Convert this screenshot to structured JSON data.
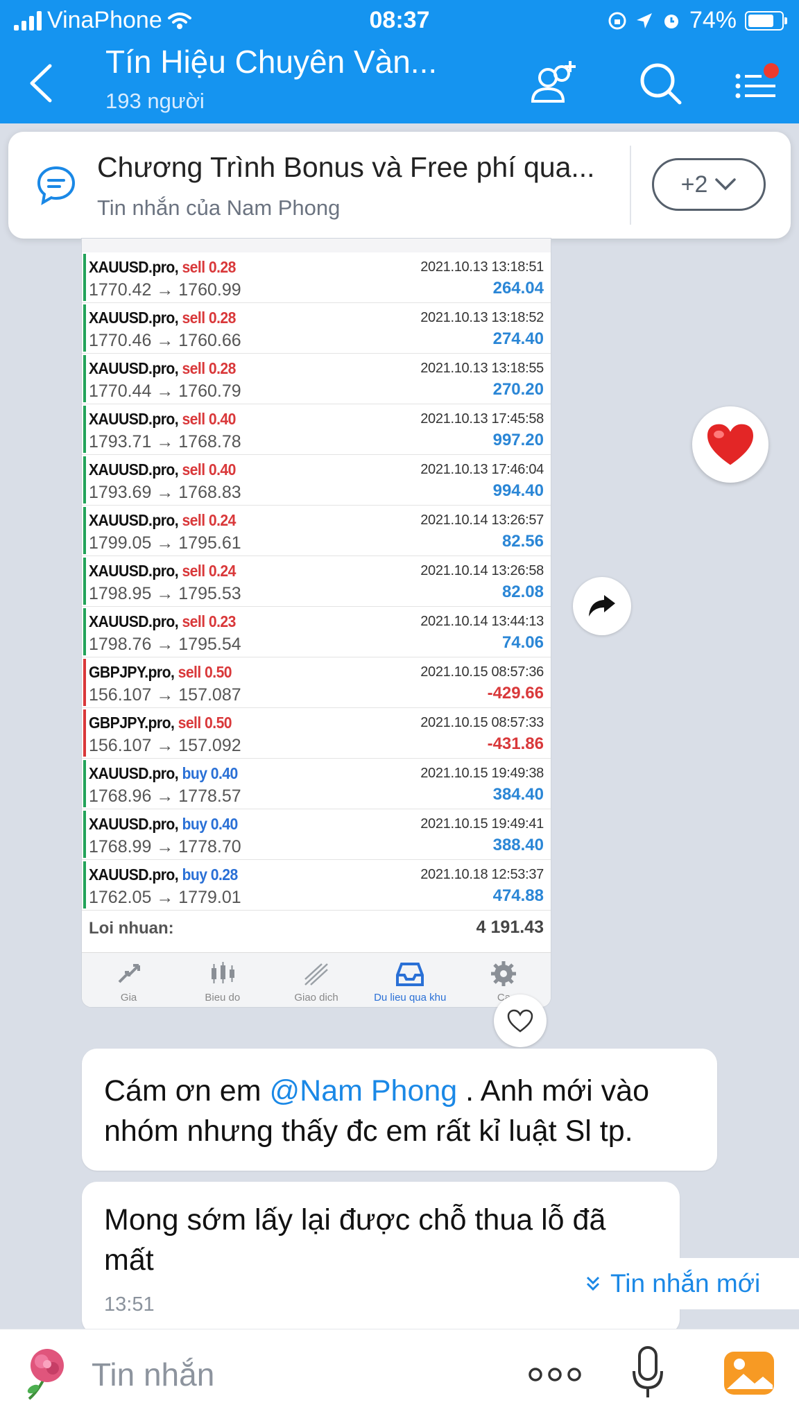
{
  "status_bar": {
    "carrier": "VinaPhone",
    "time": "08:37",
    "battery": "74%"
  },
  "header": {
    "title": "Tín Hiệu Chuyên Vàn...",
    "member_count": "193 người"
  },
  "pinned": {
    "title": "Chương Trình Bonus và Free phí qua...",
    "subtitle": "Tin nhắn của Nam Phong",
    "more_count": "+2"
  },
  "trades": [
    {
      "symbol": "XAUUSD.pro,",
      "side": "sell",
      "volume": "0.28",
      "prices": "1770.42 → 1760.99",
      "date": "2021.10.13 13:18:51",
      "profit": "264.04",
      "loss": false
    },
    {
      "symbol": "XAUUSD.pro,",
      "side": "sell",
      "volume": "0.28",
      "prices": "1770.46 → 1760.66",
      "date": "2021.10.13 13:18:52",
      "profit": "274.40",
      "loss": false
    },
    {
      "symbol": "XAUUSD.pro,",
      "side": "sell",
      "volume": "0.28",
      "prices": "1770.44 → 1760.79",
      "date": "2021.10.13 13:18:55",
      "profit": "270.20",
      "loss": false
    },
    {
      "symbol": "XAUUSD.pro,",
      "side": "sell",
      "volume": "0.40",
      "prices": "1793.71 → 1768.78",
      "date": "2021.10.13 17:45:58",
      "profit": "997.20",
      "loss": false
    },
    {
      "symbol": "XAUUSD.pro,",
      "side": "sell",
      "volume": "0.40",
      "prices": "1793.69 → 1768.83",
      "date": "2021.10.13 17:46:04",
      "profit": "994.40",
      "loss": false
    },
    {
      "symbol": "XAUUSD.pro,",
      "side": "sell",
      "volume": "0.24",
      "prices": "1799.05 → 1795.61",
      "date": "2021.10.14 13:26:57",
      "profit": "82.56",
      "loss": false
    },
    {
      "symbol": "XAUUSD.pro,",
      "side": "sell",
      "volume": "0.24",
      "prices": "1798.95 → 1795.53",
      "date": "2021.10.14 13:26:58",
      "profit": "82.08",
      "loss": false
    },
    {
      "symbol": "XAUUSD.pro,",
      "side": "sell",
      "volume": "0.23",
      "prices": "1798.76 → 1795.54",
      "date": "2021.10.14 13:44:13",
      "profit": "74.06",
      "loss": false
    },
    {
      "symbol": "GBPJPY.pro,",
      "side": "sell",
      "volume": "0.50",
      "prices": "156.107 → 157.087",
      "date": "2021.10.15 08:57:36",
      "profit": "-429.66",
      "loss": true
    },
    {
      "symbol": "GBPJPY.pro,",
      "side": "sell",
      "volume": "0.50",
      "prices": "156.107 → 157.092",
      "date": "2021.10.15 08:57:33",
      "profit": "-431.86",
      "loss": true
    },
    {
      "symbol": "XAUUSD.pro,",
      "side": "buy",
      "volume": "0.40",
      "prices": "1768.96 → 1778.57",
      "date": "2021.10.15 19:49:38",
      "profit": "384.40",
      "loss": false
    },
    {
      "symbol": "XAUUSD.pro,",
      "side": "buy",
      "volume": "0.40",
      "prices": "1768.99 → 1778.70",
      "date": "2021.10.15 19:49:41",
      "profit": "388.40",
      "loss": false
    },
    {
      "symbol": "XAUUSD.pro,",
      "side": "buy",
      "volume": "0.28",
      "prices": "1762.05 → 1779.01",
      "date": "2021.10.18 12:53:37",
      "profit": "474.88",
      "loss": false
    }
  ],
  "total": {
    "label": "Loi nhuan:",
    "value": "4 191.43"
  },
  "mt_nav": [
    {
      "label": "Gia",
      "icon": "price-icon"
    },
    {
      "label": "Bieu do",
      "icon": "chart-icon"
    },
    {
      "label": "Giao dich",
      "icon": "trade-icon"
    },
    {
      "label": "Du lieu qua khu",
      "icon": "history-icon"
    },
    {
      "label": "Ca",
      "icon": "settings-icon"
    }
  ],
  "messages": {
    "m1_prefix": "Cám ơn em",
    "m1_mention": "@Nam Phong",
    "m1_suffix": ". Anh mới vào nhóm nhưng thấy đc em rất kỉ luật Sl tp.",
    "m2_text": "Mong sớm lấy lại được chỗ thua lỗ đã mất",
    "m2_time": "13:51"
  },
  "new_message_label": "Tin nhắn mới",
  "input": {
    "placeholder": "Tin nhắn"
  },
  "colors": {
    "header_blue": "#1594f0",
    "profit_blue": "#2a86d6",
    "loss_red": "#d9383a",
    "mention_blue": "#1a88e6"
  }
}
